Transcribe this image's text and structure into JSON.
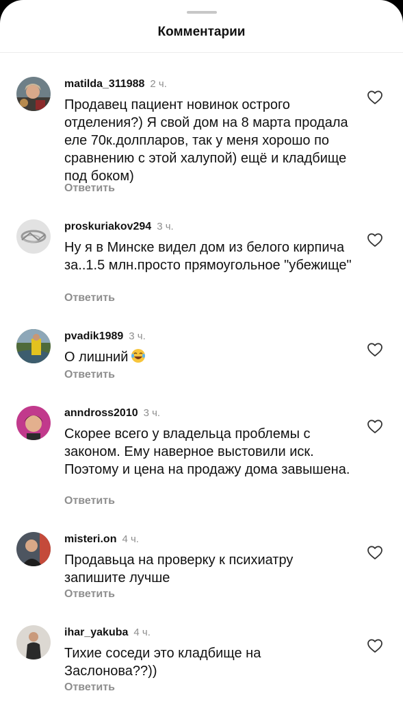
{
  "header": {
    "title": "Комментарии"
  },
  "comments": [
    {
      "username": "matilda_311988",
      "time": "2 ч.",
      "text": "Продавец пациент новинок острого отделения?) Я свой дом на 8 марта продала еле 70к.долпларов, так у меня хорошо по сравнению с этой халупой) ещё и кладбище под боком)",
      "reply_label": "Ответить",
      "avatar_icon": "user-photo-icon"
    },
    {
      "username": "proskuriakov294",
      "time": "3 ч.",
      "text": "Ну я в Минске видел дом из белого кирпича за..1.5 млн.просто прямоугольное \"убежище\"",
      "reply_label": "Ответить",
      "avatar_icon": "user-photo-icon"
    },
    {
      "username": "pvadik1989",
      "time": "3 ч.",
      "text": "О лишний",
      "emoji": "tears-of-joy-emoji",
      "reply_label": "Ответить",
      "avatar_icon": "user-photo-icon"
    },
    {
      "username": "anndross2010",
      "time": "3 ч.",
      "text": "Скорее всего у владельца проблемы с законом. Ему наверное выстовили иск. Поэтому и цена на продажу дома завышена.",
      "reply_label": "Ответить",
      "avatar_icon": "user-photo-icon"
    },
    {
      "username": "misteri.on",
      "time": "4 ч.",
      "text": "Продавьца на проверку к психиатру запишите лучше",
      "reply_label": "Ответить",
      "avatar_icon": "user-photo-icon"
    },
    {
      "username": "ihar_yakuba",
      "time": "4 ч.",
      "text": "Тихие соседи это кладбище на Заслонова??))",
      "reply_label": "Ответить",
      "avatar_icon": "user-photo-icon"
    }
  ],
  "colors": {
    "text": "#111111",
    "secondary": "#8e8e8e",
    "background": "#ffffff"
  }
}
